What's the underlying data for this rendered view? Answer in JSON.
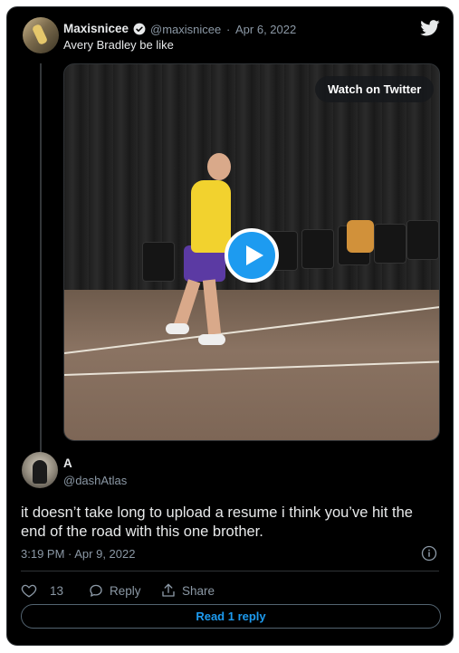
{
  "colors": {
    "background": "#000000",
    "text": "#e7e9ea",
    "muted": "#8b98a5",
    "accent": "#1d9bf0",
    "border": "#2f3336"
  },
  "quoted_tweet": {
    "author_name": "Maxisnicee",
    "author_handle": "@maxisnicee",
    "separator": "·",
    "date": "Apr 6, 2022",
    "text": "Avery Bradley be like",
    "verified_icon": "verified-badge-icon",
    "avatar_icon": "avatar",
    "media": {
      "watch_label": "Watch on Twitter",
      "play_icon": "play-icon"
    }
  },
  "reply": {
    "author_name": "A",
    "author_handle": "@dashAtlas",
    "text": "it doesn’t take long to upload a resume i think you’ve hit the end of the road with this one brother.",
    "timestamp": "3:19 PM · Apr 9, 2022",
    "info_icon": "info-icon"
  },
  "actions": {
    "like_count": "13",
    "reply_label": "Reply",
    "share_label": "Share",
    "icons": [
      "heart-icon",
      "reply-bubble-icon",
      "share-icon"
    ]
  },
  "read_replies_label": "Read 1 reply",
  "brand_icon": "twitter-bird-icon"
}
